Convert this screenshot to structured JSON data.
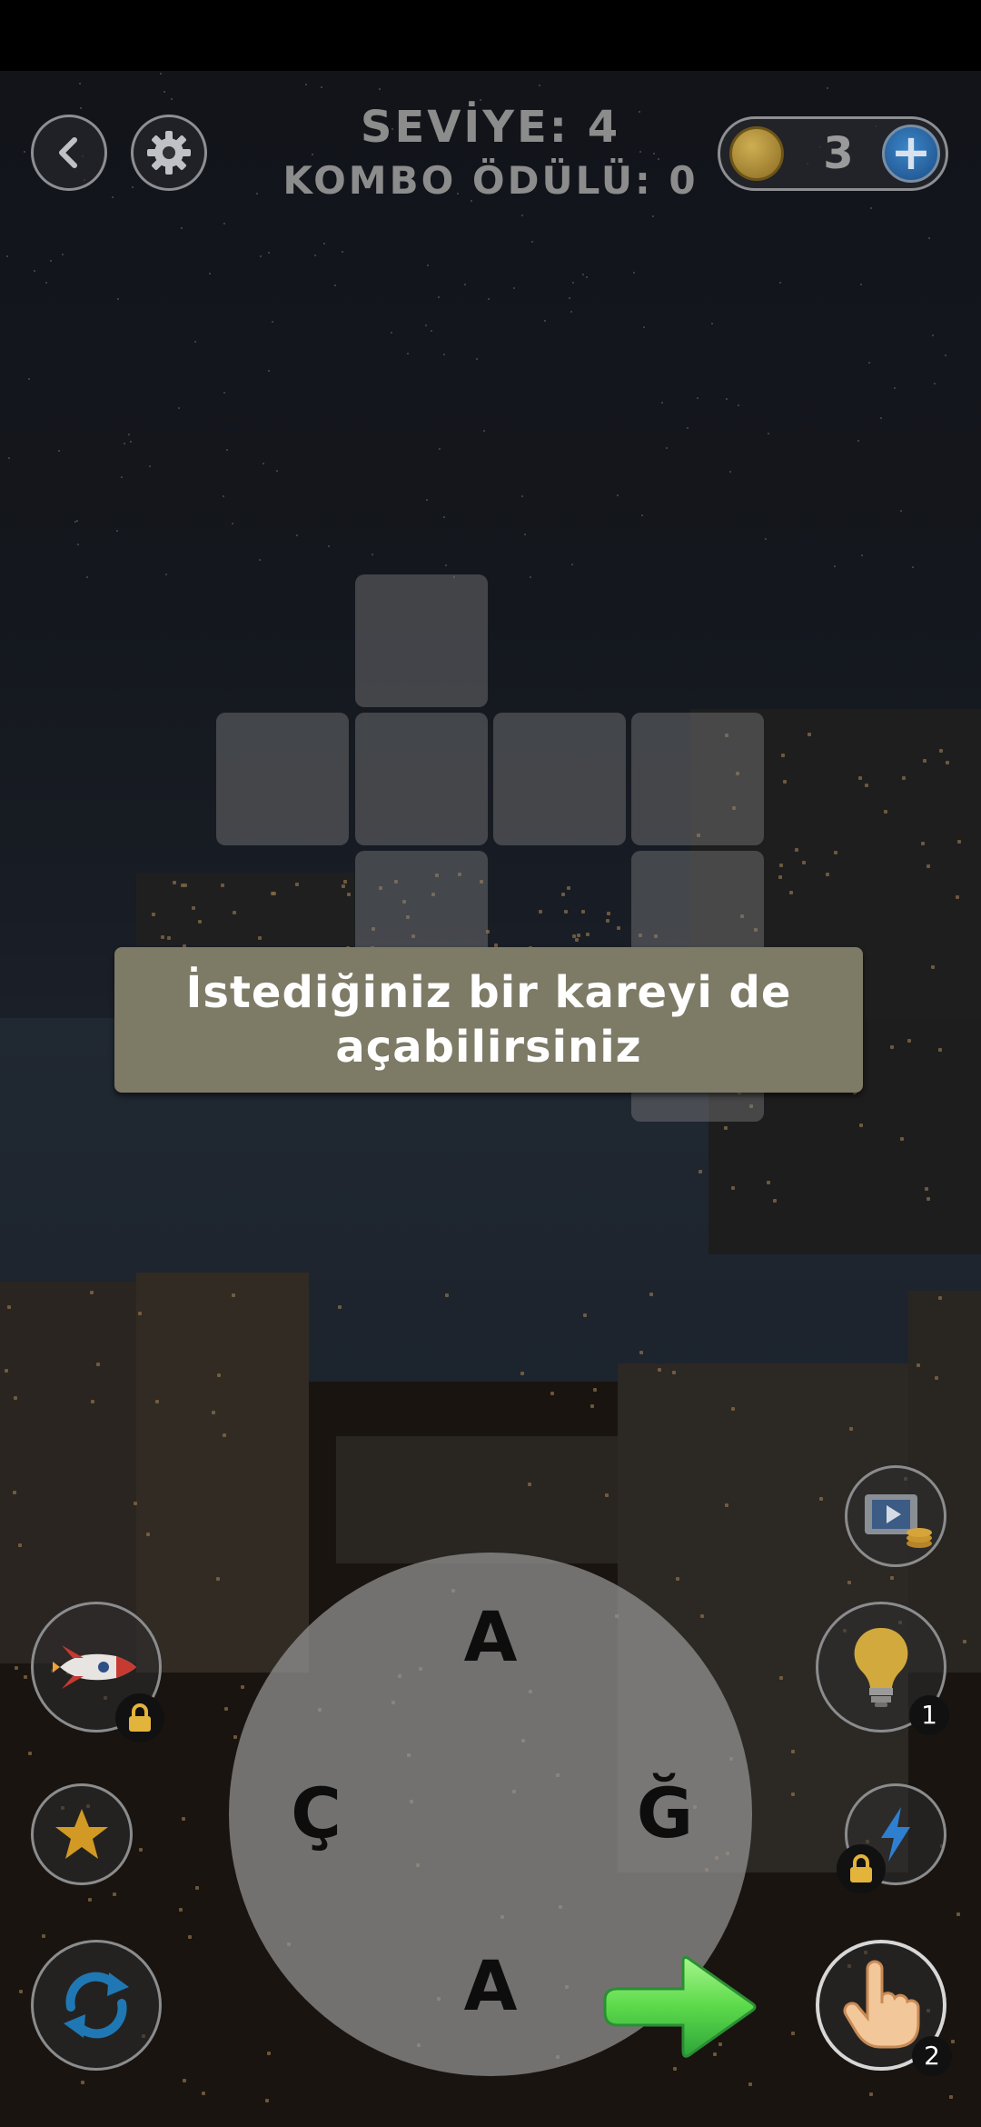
{
  "header": {
    "level_text": "SEVİYE: 4",
    "combo_text": "KOMBO ÖDÜLÜ: 0"
  },
  "coins": {
    "count": "3"
  },
  "tooltip": {
    "line1": "İstediğiniz bir kareyi de",
    "line2": "açabilirsiniz"
  },
  "wheel": {
    "letters": [
      "A",
      "Ğ",
      "A",
      "Ç"
    ]
  },
  "powerups": {
    "hint_count": "1",
    "tap_count": "2"
  },
  "icons": {
    "back": "chevron-left-icon",
    "settings": "gear-icon",
    "coin": "coin-icon",
    "add": "plus-icon",
    "rocket": "rocket-icon",
    "star": "star-icon",
    "shuffle": "refresh-icon",
    "video": "video-coins-icon",
    "hint": "lightbulb-icon",
    "lightning": "lightning-icon",
    "tap": "hand-pointer-icon",
    "next": "green-arrow-icon",
    "lock": "lock-icon"
  },
  "colors": {
    "tooltip_bg": "#7d7a66",
    "header_text": "#8c8c8c",
    "arrow": "#6ee35a",
    "plus_button": "#2a6aae"
  }
}
